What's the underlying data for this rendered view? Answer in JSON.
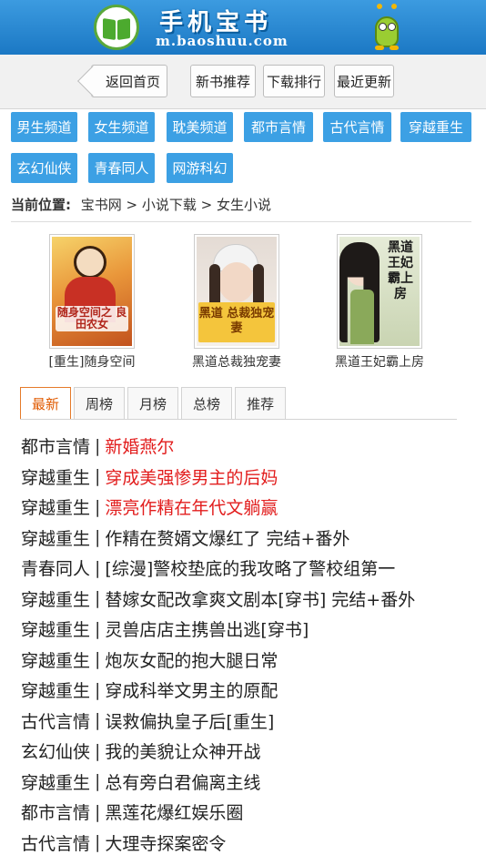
{
  "header": {
    "title": "手机宝书",
    "url": "m.baoshuu.com"
  },
  "nav": {
    "back": "返回首页",
    "buttons": [
      "新书推荐",
      "下载排行",
      "最近更新"
    ]
  },
  "categories": [
    "男生频道",
    "女生频道",
    "耽美频道",
    "都市言情",
    "古代言情",
    "穿越重生",
    "玄幻仙侠",
    "青春同人",
    "网游科幻"
  ],
  "breadcrumb": {
    "label": "当前位置:",
    "path": "宝书网 > 小说下载 > 女生小说"
  },
  "featured": [
    {
      "title": "[重生]随身空间",
      "cover_text": "随身空间之 良田农女"
    },
    {
      "title": "黑道总裁独宠妻",
      "cover_text": "黑道 总裁独宠妻"
    },
    {
      "title": "黑道王妃霸上房",
      "cover_text": "黑道王妃 霸上房"
    }
  ],
  "tabs": [
    "最新",
    "周榜",
    "月榜",
    "总榜",
    "推荐"
  ],
  "list": [
    {
      "cat": "都市言情",
      "title": "新婚燕尔",
      "hot": true
    },
    {
      "cat": "穿越重生",
      "title": "穿成美强惨男主的后妈",
      "hot": true
    },
    {
      "cat": "穿越重生",
      "title": "漂亮作精在年代文躺赢",
      "hot": true
    },
    {
      "cat": "穿越重生",
      "title": "作精在赘婿文爆红了 完结+番外",
      "hot": false
    },
    {
      "cat": "青春同人",
      "title": "[综漫]警校垫底的我攻略了警校组第一",
      "hot": false
    },
    {
      "cat": "穿越重生",
      "title": "替嫁女配改拿爽文剧本[穿书] 完结+番外",
      "hot": false
    },
    {
      "cat": "穿越重生",
      "title": "灵兽店店主携兽出逃[穿书]",
      "hot": false
    },
    {
      "cat": "穿越重生",
      "title": "炮灰女配的抱大腿日常",
      "hot": false
    },
    {
      "cat": "穿越重生",
      "title": "穿成科举文男主的原配",
      "hot": false
    },
    {
      "cat": "古代言情",
      "title": "误救偏执皇子后[重生]",
      "hot": false
    },
    {
      "cat": "玄幻仙侠",
      "title": "我的美貌让众神开战",
      "hot": false
    },
    {
      "cat": "穿越重生",
      "title": "总有旁白君偏离主线",
      "hot": false
    },
    {
      "cat": "都市言情",
      "title": "黑莲花爆红娱乐圈",
      "hot": false
    },
    {
      "cat": "古代言情",
      "title": "大理寺探案密令",
      "hot": false
    }
  ],
  "colors": {
    "header": "#1b78c4",
    "category": "#3ca0e4",
    "hot": "#e21d1d",
    "active_tab": "#e05a00"
  }
}
